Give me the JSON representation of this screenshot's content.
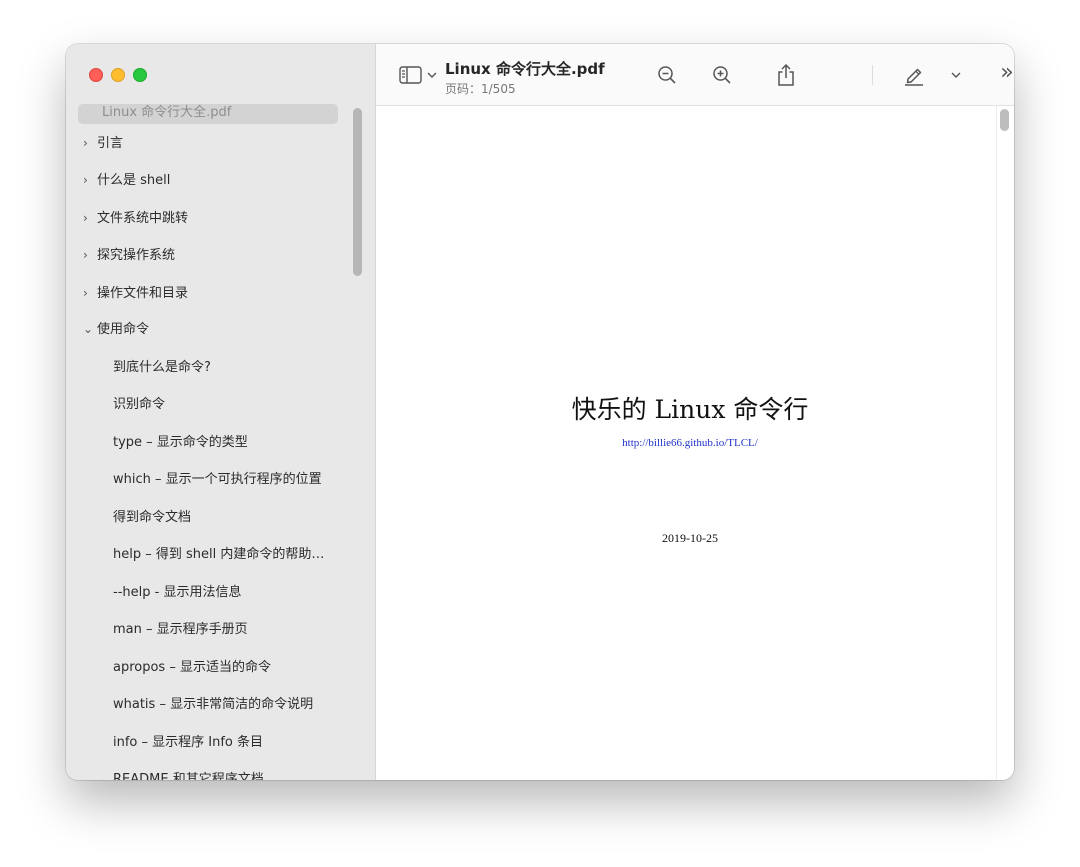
{
  "window": {
    "title": "Linux 命令行大全.pdf",
    "subtitle": "页码：1/505"
  },
  "sidebar": {
    "document_row": "Linux 命令行大全.pdf",
    "items": [
      {
        "label": "引言",
        "type": "collapsed"
      },
      {
        "label": "什么是 shell",
        "type": "collapsed"
      },
      {
        "label": "文件系统中跳转",
        "type": "collapsed"
      },
      {
        "label": "探究操作系统",
        "type": "collapsed"
      },
      {
        "label": "操作文件和目录",
        "type": "collapsed"
      },
      {
        "label": "使用命令",
        "type": "expanded"
      },
      {
        "label": "到底什么是命令?",
        "type": "child"
      },
      {
        "label": "识别命令",
        "type": "child"
      },
      {
        "label": "type – 显示命令的类型",
        "type": "child"
      },
      {
        "label": "which – 显示一个可执行程序的位置",
        "type": "child"
      },
      {
        "label": "得到命令文档",
        "type": "child"
      },
      {
        "label": "help – 得到 shell 内建命令的帮助…",
        "type": "child"
      },
      {
        "label": "--help - 显示用法信息",
        "type": "child"
      },
      {
        "label": "man – 显示程序手册页",
        "type": "child"
      },
      {
        "label": "apropos – 显示适当的命令",
        "type": "child"
      },
      {
        "label": "whatis – 显示非常简洁的命令说明",
        "type": "child"
      },
      {
        "label": "info – 显示程序 Info 条目",
        "type": "child"
      },
      {
        "label": "README 和其它程序文档",
        "type": "child"
      }
    ],
    "chevron_collapsed": "›",
    "chevron_expanded": "⌄"
  },
  "toolbar": {
    "icons": [
      "sidebar-toggle-icon",
      "chevron-down-icon",
      "zoom-out-icon",
      "zoom-in-icon",
      "share-icon",
      "highlight-pen-icon",
      "chevron-down-icon",
      "more-chevrons-icon",
      "search-icon"
    ],
    "more_label": "»"
  },
  "page": {
    "title": "快乐的 Linux 命令行",
    "link": "http://billie66.github.io/TLCL/",
    "date": "2019-10-25"
  },
  "colors": {
    "close": "#ff5f57",
    "minimize": "#febc2e",
    "zoom": "#28c840",
    "link": "#1f33c9",
    "sidebar_bg": "#e8e8e8"
  }
}
